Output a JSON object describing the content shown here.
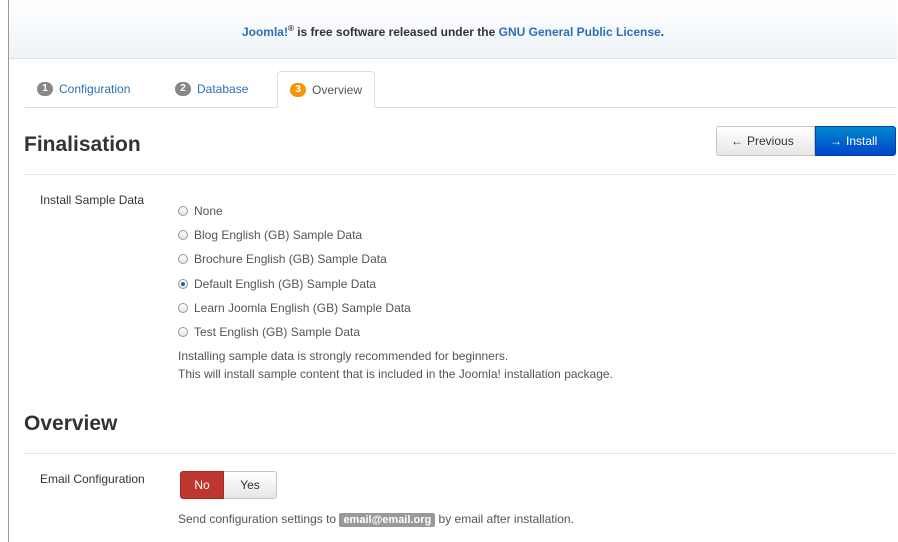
{
  "license": {
    "brand": "Joomla!",
    "registered": "®",
    "text": " is free software released under the ",
    "link": "GNU General Public License",
    "end": "."
  },
  "tabs": [
    {
      "num": "1",
      "label": "Configuration"
    },
    {
      "num": "2",
      "label": "Database"
    },
    {
      "num": "3",
      "label": "Overview"
    }
  ],
  "finalisation": {
    "heading": "Finalisation",
    "previous_label": "Previous",
    "install_label": "Install",
    "previous_arrow": "←",
    "install_arrow": "→"
  },
  "sample_data": {
    "label": "Install Sample Data",
    "options": [
      {
        "label": "None",
        "checked": false
      },
      {
        "label": "Blog English (GB) Sample Data",
        "checked": false
      },
      {
        "label": "Brochure English (GB) Sample Data",
        "checked": false
      },
      {
        "label": "Default English (GB) Sample Data",
        "checked": true
      },
      {
        "label": "Learn Joomla English (GB) Sample Data",
        "checked": false
      },
      {
        "label": "Test English (GB) Sample Data",
        "checked": false
      }
    ],
    "help_line1": "Installing sample data is strongly recommended for beginners.",
    "help_line2": "This will install sample content that is included in the Joomla! installation package."
  },
  "overview": {
    "heading": "Overview",
    "email_label": "Email Configuration",
    "no_label": "No",
    "yes_label": "Yes",
    "selected": "No",
    "send_prefix": "Send configuration settings to ",
    "email": "email@email.org",
    "send_suffix": " by email after installation."
  },
  "colors": {
    "link": "#2b6fb6",
    "install_button": "#0055cc",
    "no_active": "#bd362f",
    "active_badge": "#f89406"
  }
}
